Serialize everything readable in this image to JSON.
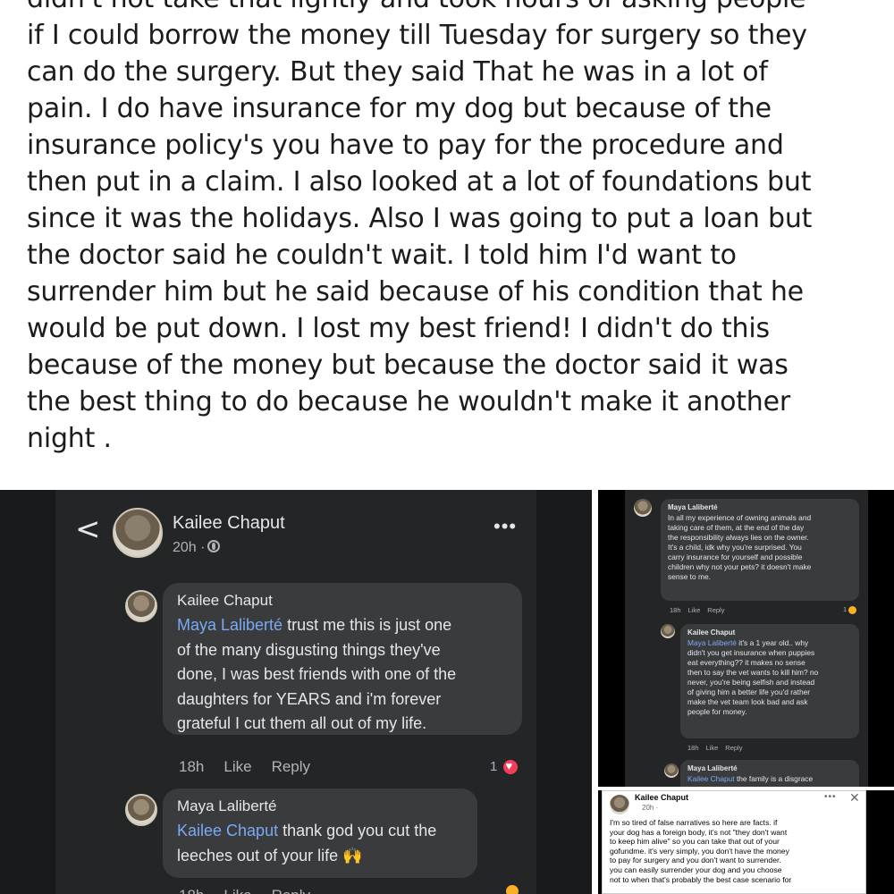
{
  "post": {
    "lines": [
      "didn't not take that lightly and took hours of asking people",
      "if I could borrow the money till Tuesday for surgery so they",
      "can do the surgery. But they said That he was in a lot of",
      "pain. I do have insurance for my dog but because of the",
      "insurance policy's you  have to pay for the procedure and",
      "then put in a claim. I also looked at a lot of foundations but",
      "since it was the holidays. Also I was going to put a loan but",
      "the doctor said he couldn't wait. I told him I'd want to",
      "surrender him but he said because of his condition that he",
      "would be put down.  I lost my best friend! I didn't do this",
      "because of the money but because the doctor said it was",
      "the best thing to do because he wouldn't make it another",
      "night ."
    ]
  },
  "main_panel": {
    "header": {
      "back": "<",
      "name": "Kailee Chaput",
      "time": "20h ·",
      "more": "•••"
    },
    "comments": [
      {
        "name": "Kailee Chaput",
        "mention": "Maya Laliberté",
        "text_first": " trust me this is just one",
        "lines": [
          "of the many disgusting things they've",
          "done, I was best friends with one of the",
          "daughters for YEARS and i'm forever",
          "grateful I cut them all out of my life."
        ],
        "time": "18h",
        "like": "Like",
        "reply": "Reply",
        "reactions": "1"
      },
      {
        "name": "Maya Laliberté",
        "mention": "Kailee Chaput",
        "text_first": " thank god you cut the",
        "lines": [
          "leeches out of your life"
        ],
        "time": "18h",
        "like": "Like",
        "reply": "Reply"
      }
    ]
  },
  "right_top": {
    "comment1": {
      "name": "Maya Laliberté",
      "lines": [
        "In all my experience of owning animals and",
        "taking care of them, at the end of the day",
        "the responsibility always lies on the owner.",
        "It's a child, idk why you're surprised. You",
        "carry insurance for yourself and possible",
        "children why not your pets? it doesn't make",
        "sense to me."
      ],
      "time": "18h",
      "like": "Like",
      "reply": "Reply",
      "reactions": "1"
    },
    "comment2": {
      "name": "Kailee Chaput",
      "mention": "Maya Laliberté",
      "text_first": " it's a 1 year old.. why",
      "lines": [
        "didn't you get insurance when puppies",
        "eat everything?? it makes no sense",
        "then to say the vet wants to kill him? no",
        "never, you're being selfish and instead",
        "of giving him a better life you'd rather",
        "make the vet team look bad and ask",
        "people for money."
      ],
      "time": "18h",
      "like": "Like",
      "reply": "Reply"
    },
    "comment3": {
      "name": "Maya Laliberté",
      "mention": "Kailee Chaput",
      "text_first": " the family is a disgrace"
    }
  },
  "right_bottom": {
    "name": "Kailee Chaput",
    "time": "20h ·",
    "more": "•••",
    "close": "✕",
    "lines": [
      "I'm so tired of false narratives so here are facts. if",
      "your dog has a foreign body, it's not \"they don't want",
      "to keep him alive\" so you can take that out of your",
      "gofundme. it's very simply, you don't have the money",
      "to pay for surgery and you don't want to surrender.",
      "you can easily surrender your dog and you choose",
      "not to when that's probably the best case scenario for"
    ]
  },
  "colors": {
    "panel_bg": "#242526",
    "bubble_bg": "#3a3b3c",
    "mention": "#7aaaf7",
    "heart": "#f33e58"
  }
}
